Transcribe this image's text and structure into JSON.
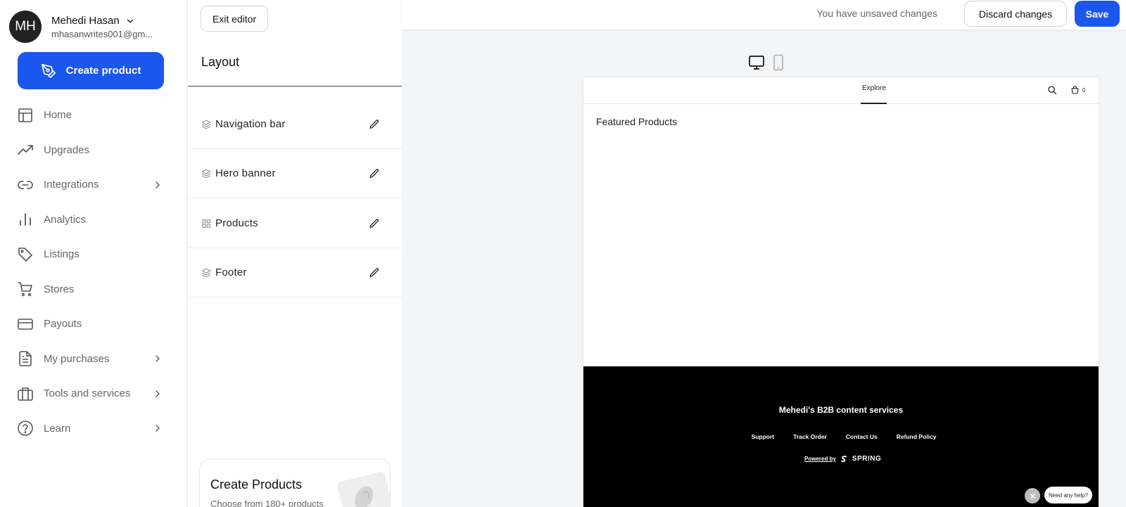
{
  "user": {
    "initials": "MH",
    "name": "Mehedi Hasan",
    "email": "mhasanwrites001@gm..."
  },
  "sidebar": {
    "create_label": "Create product",
    "items": [
      {
        "label": "Home",
        "icon": "layout-icon"
      },
      {
        "label": "Upgrades",
        "icon": "trending-up-icon"
      },
      {
        "label": "Integrations",
        "icon": "link-icon",
        "has_children": true
      },
      {
        "label": "Analytics",
        "icon": "bar-chart-icon"
      },
      {
        "label": "Listings",
        "icon": "tag-icon"
      },
      {
        "label": "Stores",
        "icon": "cart-icon"
      },
      {
        "label": "Payouts",
        "icon": "credit-card-icon"
      },
      {
        "label": "My purchases",
        "icon": "file-icon",
        "has_children": true
      },
      {
        "label": "Tools and services",
        "icon": "briefcase-icon",
        "has_children": true
      },
      {
        "label": "Learn",
        "icon": "help-circle-icon",
        "has_children": true
      }
    ]
  },
  "editor": {
    "exit_label": "Exit editor",
    "layout_title": "Layout",
    "sections": [
      {
        "label": "Navigation bar",
        "icon": "layers-icon"
      },
      {
        "label": "Hero banner",
        "icon": "layers-icon"
      },
      {
        "label": "Products",
        "icon": "grid-icon"
      },
      {
        "label": "Footer",
        "icon": "layers-icon"
      }
    ],
    "promo": {
      "title": "Create Products",
      "subtitle": "Choose from 180+ products"
    }
  },
  "topbar": {
    "unsaved_text": "You have unsaved changes",
    "discard_label": "Discard changes",
    "save_label": "Save"
  },
  "preview": {
    "nav_link": "Explore",
    "cart_count": "0",
    "featured_title": "Featured Products",
    "footer": {
      "company": "Mehedi's B2B content services",
      "links": [
        "Support",
        "Track Order",
        "Contact Us",
        "Refund Policy"
      ],
      "powered_by": "Powered by",
      "brand": "SPRING"
    }
  },
  "help": {
    "label": "Need any help?"
  },
  "colors": {
    "accent": "#1b56ee",
    "footer_bg": "#000000"
  }
}
